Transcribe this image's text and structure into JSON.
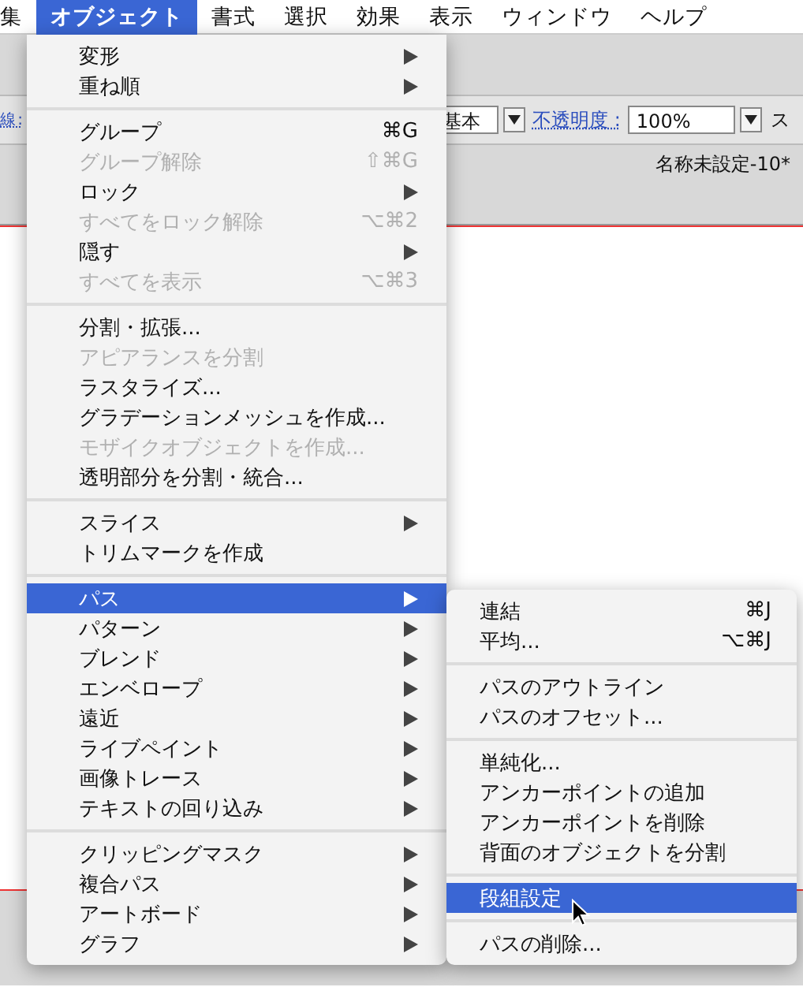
{
  "menu_bar": [
    {
      "label": "集",
      "selected": false
    },
    {
      "label": "オブジェクト",
      "selected": true
    },
    {
      "label": "書式",
      "selected": false
    },
    {
      "label": "選択",
      "selected": false
    },
    {
      "label": "効果",
      "selected": false
    },
    {
      "label": "表示",
      "selected": false
    },
    {
      "label": "ウィンドウ",
      "selected": false
    },
    {
      "label": "ヘルプ",
      "selected": false
    }
  ],
  "control_bar": {
    "stroke_label": "線 :",
    "style_value": "基本",
    "opacity_label": "不透明度 :",
    "opacity_value": "100%",
    "next_label": "ス"
  },
  "document": {
    "title": "名称未設定-10*"
  },
  "menu": {
    "groups": [
      [
        {
          "label": "変形",
          "submenu": true,
          "disabled": false,
          "selected": false
        },
        {
          "label": "重ね順",
          "submenu": true,
          "disabled": false,
          "selected": false
        }
      ],
      [
        {
          "label": "グループ",
          "shortcut": "⌘G",
          "submenu": false,
          "disabled": false,
          "selected": false
        },
        {
          "label": "グループ解除",
          "shortcut": "⇧⌘G",
          "submenu": false,
          "disabled": true,
          "selected": false
        },
        {
          "label": "ロック",
          "submenu": true,
          "disabled": false,
          "selected": false
        },
        {
          "label": "すべてをロック解除",
          "shortcut": "⌥⌘2",
          "submenu": false,
          "disabled": true,
          "selected": false
        },
        {
          "label": "隠す",
          "submenu": true,
          "disabled": false,
          "selected": false
        },
        {
          "label": "すべてを表示",
          "shortcut": "⌥⌘3",
          "submenu": false,
          "disabled": true,
          "selected": false
        }
      ],
      [
        {
          "label": "分割・拡張...",
          "submenu": false,
          "disabled": false,
          "selected": false
        },
        {
          "label": "アピアランスを分割",
          "submenu": false,
          "disabled": true,
          "selected": false
        },
        {
          "label": "ラスタライズ...",
          "submenu": false,
          "disabled": false,
          "selected": false
        },
        {
          "label": "グラデーションメッシュを作成...",
          "submenu": false,
          "disabled": false,
          "selected": false
        },
        {
          "label": "モザイクオブジェクトを作成...",
          "submenu": false,
          "disabled": true,
          "selected": false
        },
        {
          "label": "透明部分を分割・統合...",
          "submenu": false,
          "disabled": false,
          "selected": false
        }
      ],
      [
        {
          "label": "スライス",
          "submenu": true,
          "disabled": false,
          "selected": false
        },
        {
          "label": "トリムマークを作成",
          "submenu": false,
          "disabled": false,
          "selected": false
        }
      ],
      [
        {
          "label": "パス",
          "submenu": true,
          "disabled": false,
          "selected": true
        },
        {
          "label": "パターン",
          "submenu": true,
          "disabled": false,
          "selected": false
        },
        {
          "label": "ブレンド",
          "submenu": true,
          "disabled": false,
          "selected": false
        },
        {
          "label": "エンベロープ",
          "submenu": true,
          "disabled": false,
          "selected": false
        },
        {
          "label": "遠近",
          "submenu": true,
          "disabled": false,
          "selected": false
        },
        {
          "label": "ライブペイント",
          "submenu": true,
          "disabled": false,
          "selected": false
        },
        {
          "label": "画像トレース",
          "submenu": true,
          "disabled": false,
          "selected": false
        },
        {
          "label": "テキストの回り込み",
          "submenu": true,
          "disabled": false,
          "selected": false
        }
      ],
      [
        {
          "label": "クリッピングマスク",
          "submenu": true,
          "disabled": false,
          "selected": false
        },
        {
          "label": "複合パス",
          "submenu": true,
          "disabled": false,
          "selected": false
        },
        {
          "label": "アートボード",
          "submenu": true,
          "disabled": false,
          "selected": false
        },
        {
          "label": "グラフ",
          "submenu": true,
          "disabled": false,
          "selected": false
        }
      ]
    ]
  },
  "submenu": {
    "groups": [
      [
        {
          "label": "連結",
          "shortcut": "⌘J",
          "submenu": false,
          "disabled": false,
          "selected": false
        },
        {
          "label": "平均...",
          "shortcut": "⌥⌘J",
          "submenu": false,
          "disabled": false,
          "selected": false
        }
      ],
      [
        {
          "label": "パスのアウトライン",
          "submenu": false,
          "disabled": false,
          "selected": false
        },
        {
          "label": "パスのオフセット...",
          "submenu": false,
          "disabled": false,
          "selected": false
        }
      ],
      [
        {
          "label": "単純化...",
          "submenu": false,
          "disabled": false,
          "selected": false
        },
        {
          "label": "アンカーポイントの追加",
          "submenu": false,
          "disabled": false,
          "selected": false
        },
        {
          "label": "アンカーポイントを削除",
          "submenu": false,
          "disabled": false,
          "selected": false
        },
        {
          "label": "背面のオブジェクトを分割",
          "submenu": false,
          "disabled": false,
          "selected": false
        }
      ],
      [
        {
          "label": "段組設定",
          "submenu": false,
          "disabled": false,
          "selected": true
        }
      ],
      [
        {
          "label": "パスの削除...",
          "submenu": false,
          "disabled": false,
          "selected": false
        }
      ]
    ]
  }
}
